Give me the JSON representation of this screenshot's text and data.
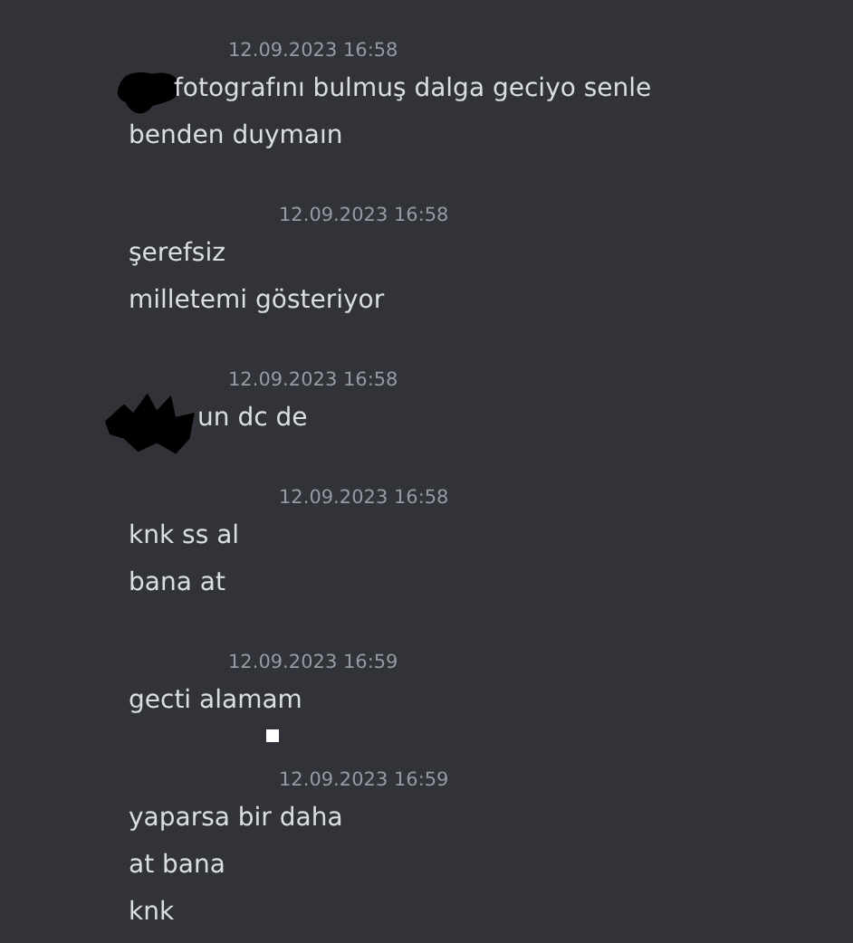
{
  "messages": [
    {
      "timestamp": "12.09.2023 16:58",
      "kind": "narrow",
      "lines": [
        {
          "text": "fotografını bulmuş dalga geciyo senle",
          "redacted": true
        },
        {
          "text": "benden duymaın",
          "redacted": false
        }
      ]
    },
    {
      "timestamp": "12.09.2023 16:58",
      "kind": "wide",
      "lines": [
        {
          "text": "şerefsiz",
          "redacted": false
        },
        {
          "text": "milletemi gösteriyor",
          "redacted": false
        }
      ]
    },
    {
      "timestamp": "12.09.2023 16:58",
      "kind": "narrow",
      "lines": [
        {
          "text": "un dc de",
          "redacted": true
        }
      ]
    },
    {
      "timestamp": "12.09.2023 16:58",
      "kind": "wide",
      "lines": [
        {
          "text": "knk ss al",
          "redacted": false
        },
        {
          "text": "bana at",
          "redacted": false
        }
      ]
    },
    {
      "timestamp": "12.09.2023 16:59",
      "kind": "narrow",
      "lines": [
        {
          "text": "gecti alamam",
          "redacted": false
        }
      ]
    },
    {
      "timestamp": "12.09.2023 16:59",
      "kind": "wide",
      "lines": [
        {
          "text": "yaparsa bir daha",
          "redacted": false
        },
        {
          "text": "at bana",
          "redacted": false
        },
        {
          "text": "knk",
          "redacted": false
        }
      ]
    }
  ]
}
